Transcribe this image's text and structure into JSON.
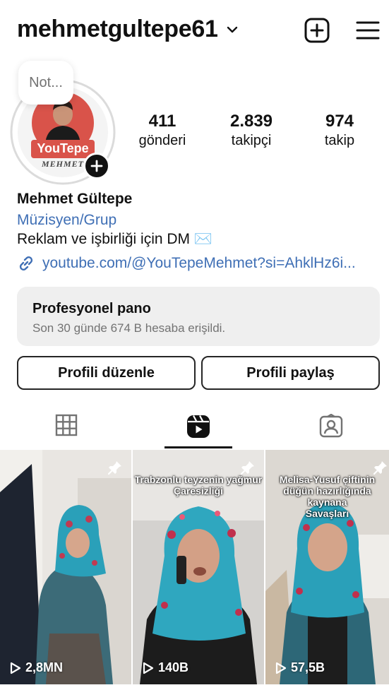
{
  "header": {
    "username": "mehmetgultepe61",
    "icons": [
      "chevron-down-icon",
      "add-post-icon",
      "menu-icon"
    ]
  },
  "profile": {
    "note_text": "Not...",
    "avatar_brand_text": "YouTepe",
    "avatar_sub_text": "MEHMET",
    "stats": [
      {
        "value": "411",
        "label": "gönderi"
      },
      {
        "value": "2.839",
        "label": "takipçi"
      },
      {
        "value": "974",
        "label": "takip"
      }
    ]
  },
  "bio": {
    "name": "Mehmet Gültepe",
    "category": "Müzisyen/Grup",
    "text": "Reklam ve işbirliği için DM ✉️",
    "link": "youtube.com/@YouTepeMehmet?si=AhklHz6i..."
  },
  "dashboard": {
    "title": "Profesyonel pano",
    "subtitle": "Son 30 günde 674 B hesaba erişildi."
  },
  "buttons": {
    "edit": "Profili düzenle",
    "share": "Profili paylaş"
  },
  "tabs": [
    {
      "icon": "grid-icon",
      "active": false
    },
    {
      "icon": "reels-icon",
      "active": true
    },
    {
      "icon": "tagged-icon",
      "active": false
    }
  ],
  "reels": [
    {
      "caption": "",
      "views": "2,8MN",
      "pinned": true
    },
    {
      "caption": "Trabzonlu teyzenin yağmur\nÇaresizliği",
      "views": "140B",
      "pinned": true
    },
    {
      "caption": "Melisa-Yusuf çiftinin\ndüğün hazırlığında kaynana\nSavaşları",
      "views": "57,5B",
      "pinned": true
    }
  ],
  "colors": {
    "link_blue": "#3f6fb5",
    "muted_gray": "#737373",
    "panel_bg": "#efefef",
    "avatar_red": "#d9534a"
  }
}
